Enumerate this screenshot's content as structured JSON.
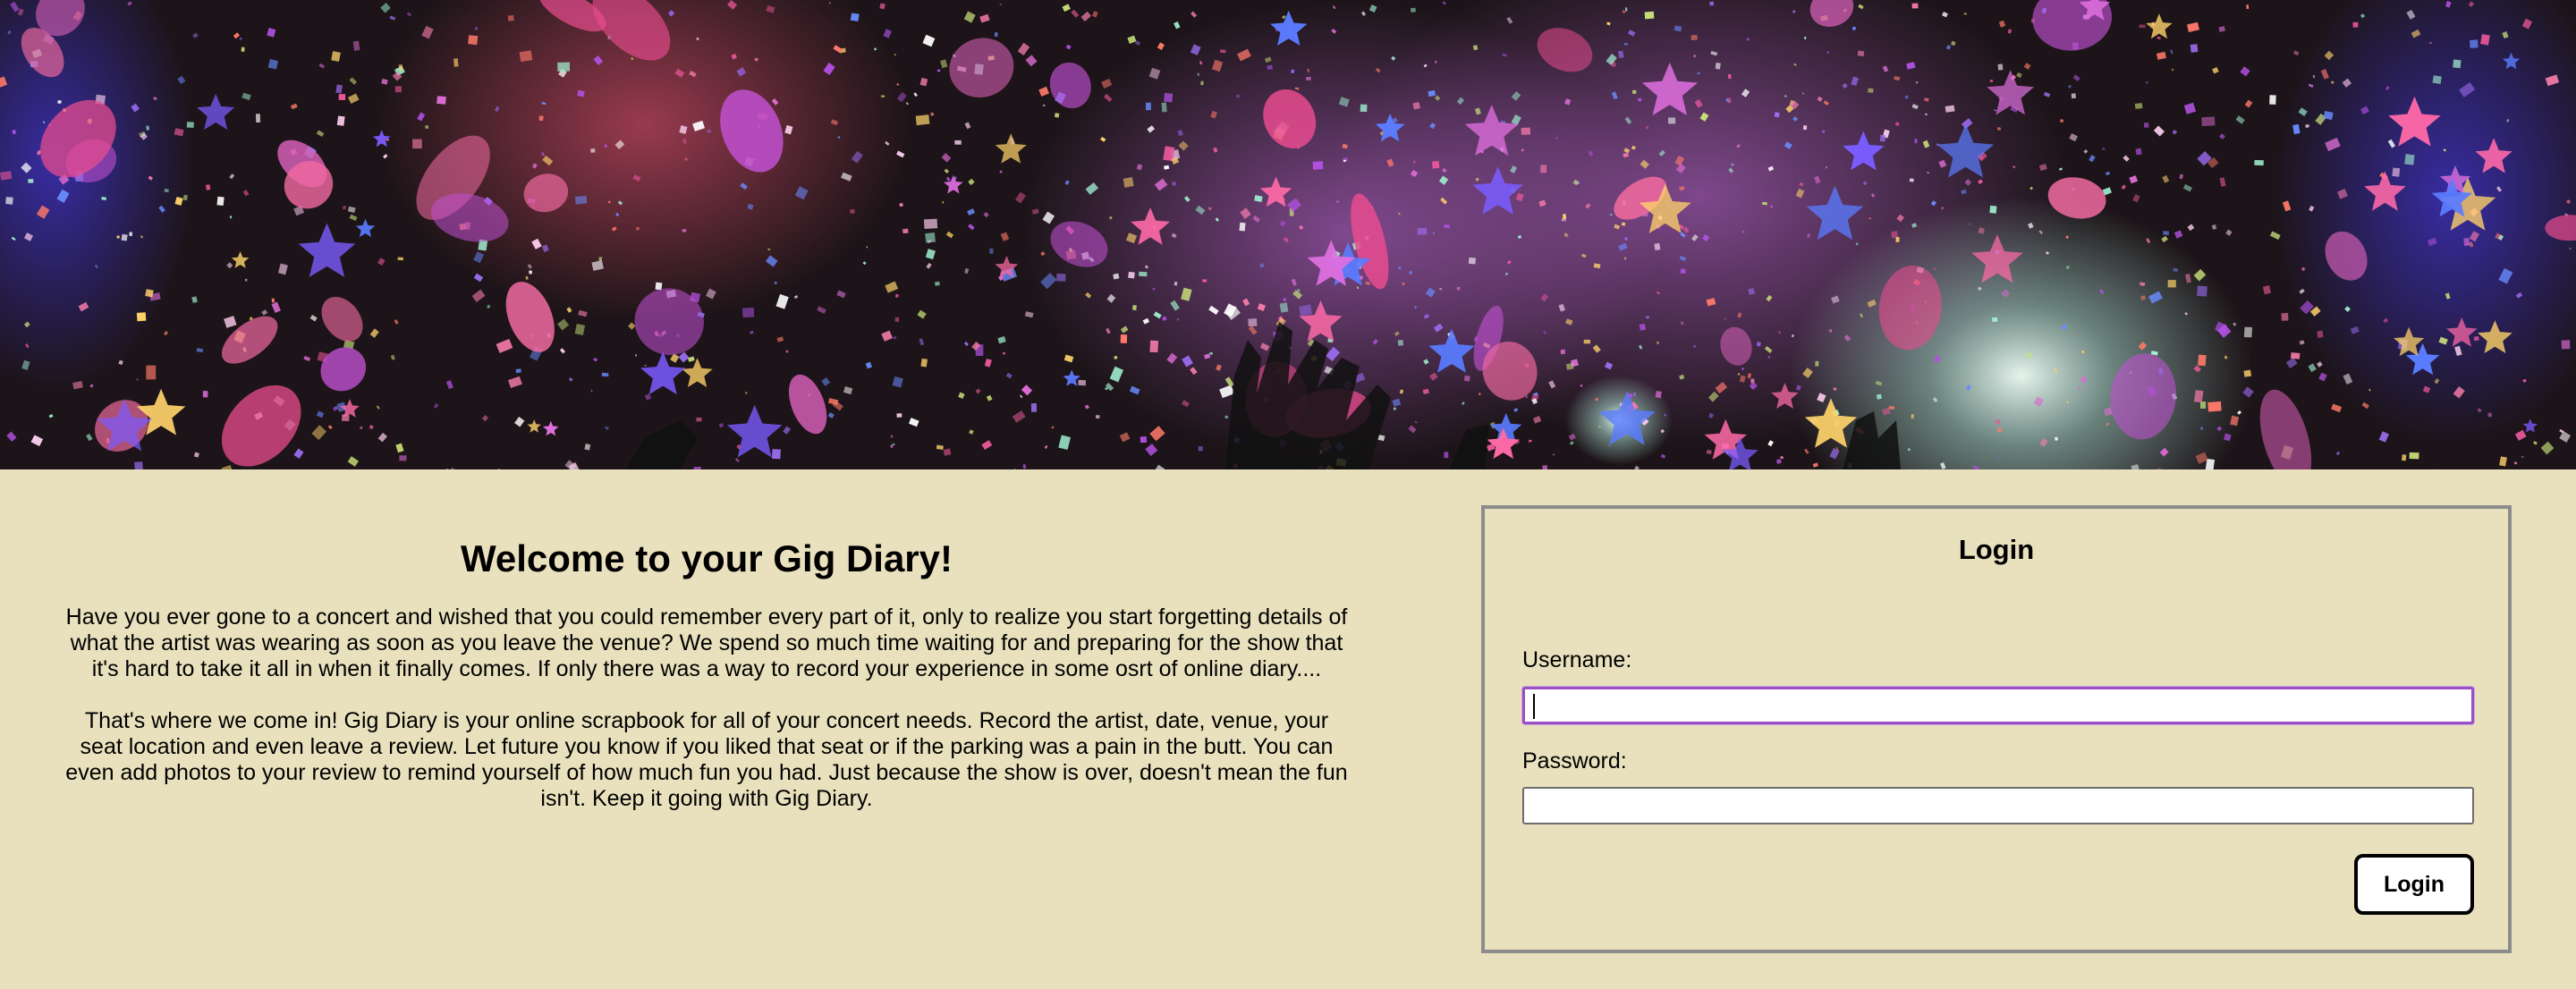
{
  "hero": {
    "image": "concert-confetti-photo"
  },
  "welcome": {
    "title": "Welcome to your Gig Diary!",
    "paragraph_1": "Have you ever gone to a concert and wished that you could remember every part of it, only to realize you start forgetting details of what the artist was wearing as soon as you leave the venue? We spend so much time waiting for and preparing for the show that it's hard to take it all in when it finally comes. If only there was a way to record your experience in some osrt of online diary....",
    "paragraph_2": "That's where we come in! Gig Diary is your online scrapbook for all of your concert needs. Record the artist, date, venue, your seat location and even leave a review. Let future you know if you liked that seat or if the parking was a pain in the butt. You can even add photos to your review to remind yourself of how much fun you had. Just because the show is over, doesn't mean the fun isn't. Keep it going with Gig Diary."
  },
  "login": {
    "title": "Login",
    "username_label": "Username:",
    "username_value": "",
    "password_label": "Password:",
    "password_value": "",
    "button_label": "Login"
  },
  "colors": {
    "page_background": "#e9e1bd",
    "box_border": "#8c8c8c",
    "focus_ring": "#9a4fc4"
  }
}
